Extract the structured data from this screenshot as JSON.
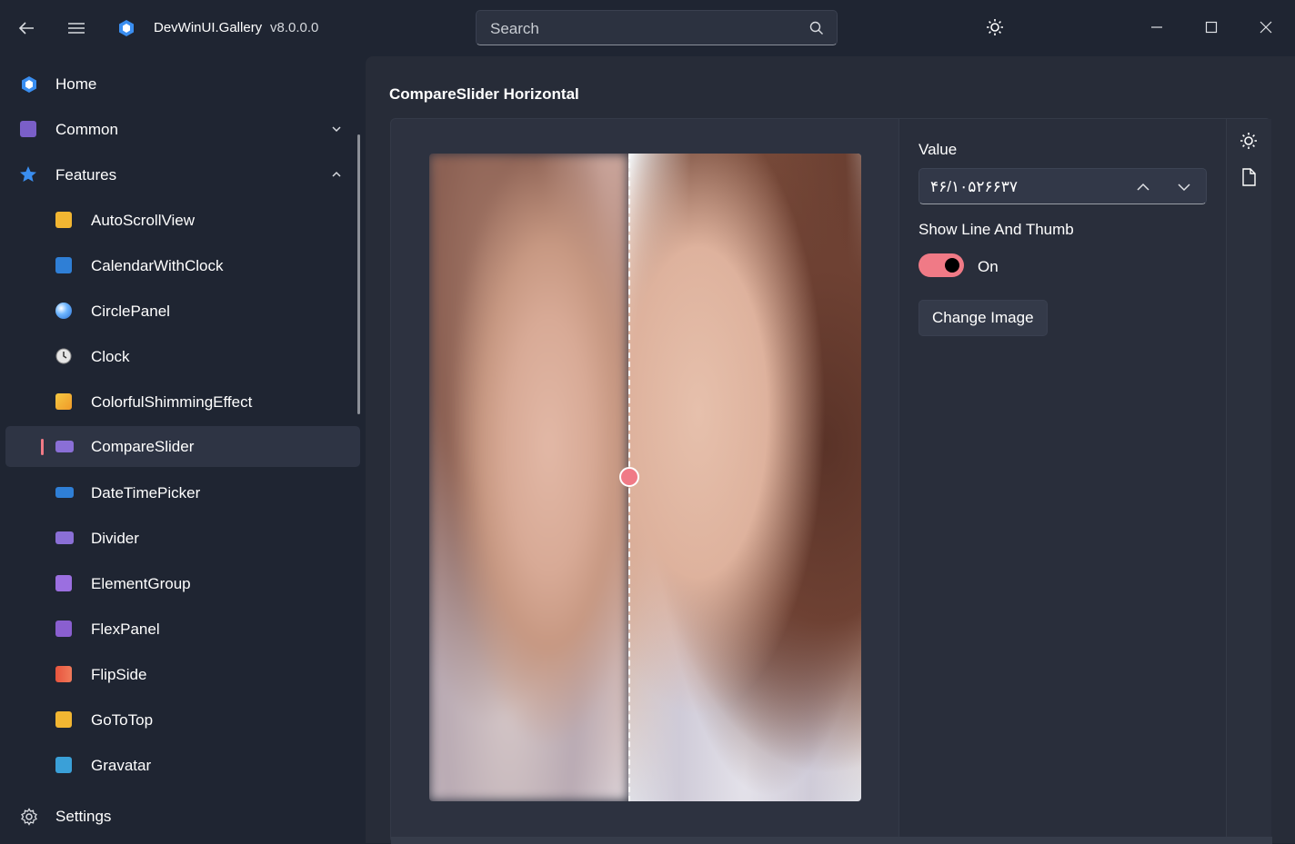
{
  "window": {
    "app_title": "DevWinUI.Gallery",
    "version": "v8.0.0.0",
    "search_placeholder": "Search",
    "icons": [
      "back-arrow-icon",
      "hamburger-menu-icon",
      "app-logo-icon",
      "search-icon",
      "theme-toggle-icon",
      "minimize-icon",
      "maximize-icon",
      "close-icon"
    ]
  },
  "sidebar": {
    "items": [
      {
        "label": "Home",
        "icon": "home-logo-icon",
        "level": 0
      },
      {
        "label": "Common",
        "icon": "common-icon",
        "level": 0,
        "expander": "chevron-down"
      },
      {
        "label": "Features",
        "icon": "star-icon",
        "level": 0,
        "expander": "chevron-up"
      },
      {
        "label": "AutoScrollView",
        "icon": "autoscrollview-icon",
        "level": 1
      },
      {
        "label": "CalendarWithClock",
        "icon": "calendar-icon",
        "level": 1
      },
      {
        "label": "CirclePanel",
        "icon": "circle-panel-icon",
        "level": 1
      },
      {
        "label": "Clock",
        "icon": "clock-icon",
        "level": 1
      },
      {
        "label": "ColorfulShimmingEffect",
        "icon": "shimmer-icon",
        "level": 1
      },
      {
        "label": "CompareSlider",
        "icon": "compare-slider-icon",
        "level": 1,
        "selected": true
      },
      {
        "label": "DateTimePicker",
        "icon": "datetime-picker-icon",
        "level": 1
      },
      {
        "label": "Divider",
        "icon": "divider-icon",
        "level": 1
      },
      {
        "label": "ElementGroup",
        "icon": "element-group-icon",
        "level": 1
      },
      {
        "label": "FlexPanel",
        "icon": "flex-panel-icon",
        "level": 1
      },
      {
        "label": "FlipSide",
        "icon": "flip-side-icon",
        "level": 1
      },
      {
        "label": "GoToTop",
        "icon": "go-to-top-icon",
        "level": 1
      },
      {
        "label": "Gravatar",
        "icon": "gravatar-icon",
        "level": 1
      }
    ],
    "settings_label": "Settings"
  },
  "main": {
    "page_title": "CompareSlider Horizontal",
    "options": {
      "value_label": "Value",
      "value": "۴۶/۱۰۵۲۶۶۳۷",
      "show_line_label": "Show Line And Thumb",
      "toggle_state": "On",
      "change_image_label": "Change Image"
    },
    "compare_slider_position": 0.46
  },
  "colors": {
    "accent": "#f07a86",
    "background": "#1f2532",
    "content_bg": "#272c38"
  }
}
